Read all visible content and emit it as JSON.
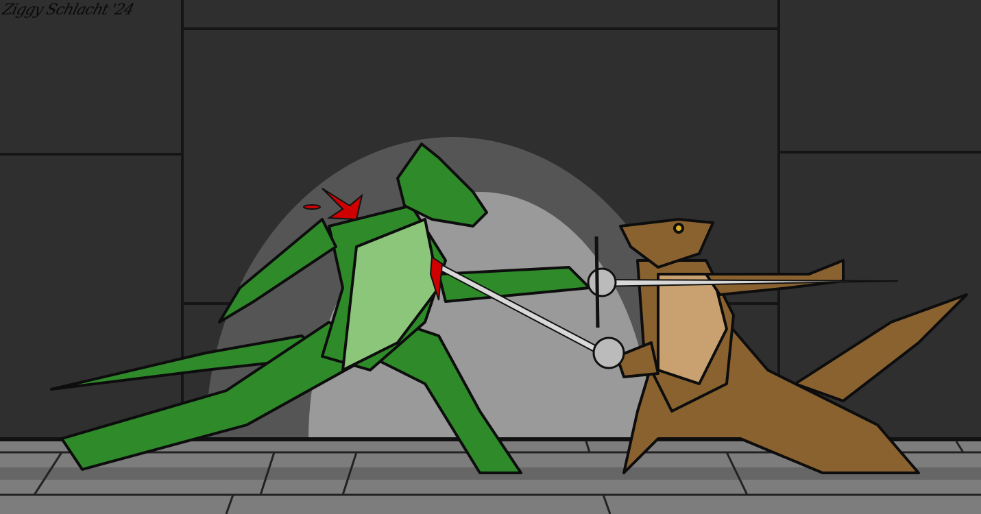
{
  "artwork": {
    "signature": "Ziggy Schlacht '24",
    "colors": {
      "wall": "#2f2f2f",
      "panel_line": "#1a1a1a",
      "spotlight_outer": "#5a5a5a",
      "spotlight_inner": "#9a9a9a",
      "floor": "#7a7a7a",
      "green_lizard": "#2f8a2a",
      "green_belly": "#8cc67a",
      "brown_lizard": "#8a6230",
      "brown_belly": "#c9a070",
      "blood": "#d00000",
      "blade": "#d8d8d8"
    }
  }
}
